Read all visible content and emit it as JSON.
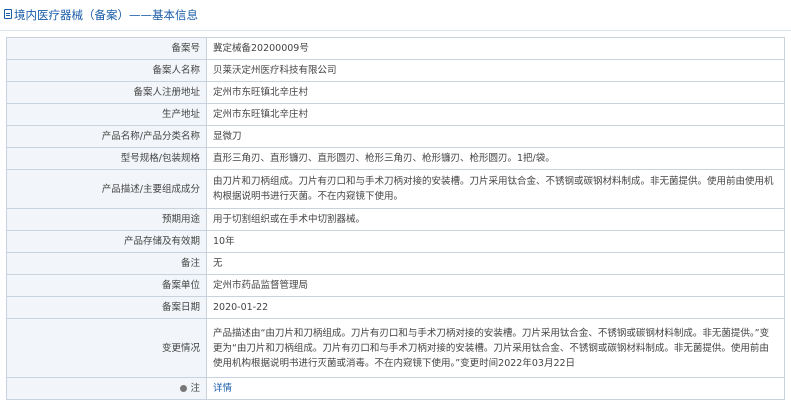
{
  "header": {
    "title": "境内医疗器械（备案）——基本信息"
  },
  "rows": [
    {
      "label": "备案号",
      "value": "冀定械备20200009号"
    },
    {
      "label": "备案人名称",
      "value": "贝莱沃定州医疗科技有限公司"
    },
    {
      "label": "备案人注册地址",
      "value": "定州市东旺镇北辛庄村"
    },
    {
      "label": "生产地址",
      "value": "定州市东旺镇北辛庄村"
    },
    {
      "label": "产品名称/产品分类名称",
      "value": "显微刀"
    },
    {
      "label": "型号规格/包装规格",
      "value": "直形三角刃、直形镰刃、直形圆刃、枪形三角刃、枪形镰刃、枪形圆刃。1把/袋。"
    },
    {
      "label": "产品描述/主要组成成分",
      "value": "由刀片和刀柄组成。刀片有刃口和与手术刀柄对接的安装槽。刀片采用钛合金、不锈钢或碳钢材料制成。非无菌提供。使用前由使用机构根据说明书进行灭菌。不在内窥镜下使用。"
    },
    {
      "label": "预期用途",
      "value": "用于切割组织或在手术中切割器械。"
    },
    {
      "label": "产品存储及有效期",
      "value": "10年"
    },
    {
      "label": "备注",
      "value": "无"
    },
    {
      "label": "备案单位",
      "value": "定州市药品监督管理局"
    },
    {
      "label": "备案日期",
      "value": "2020-01-22"
    },
    {
      "label": "变更情况",
      "value": "产品描述由“由刀片和刀柄组成。刀片有刃口和与手术刀柄对接的安装槽。刀片采用钛合金、不锈钢或碳钢材料制成。非无菌提供。”变更为“由刀片和刀柄组成。刀片有刃口和与手术刀柄对接的安装槽。刀片采用钛合金、不锈钢或碳钢材料制成。非无菌提供。使用前由使用机构根据说明书进行灭菌或消毒。不在内窥镜下使用。”变更时间2022年03月22日"
    }
  ],
  "note": {
    "label": "注",
    "link_text": "详情"
  }
}
